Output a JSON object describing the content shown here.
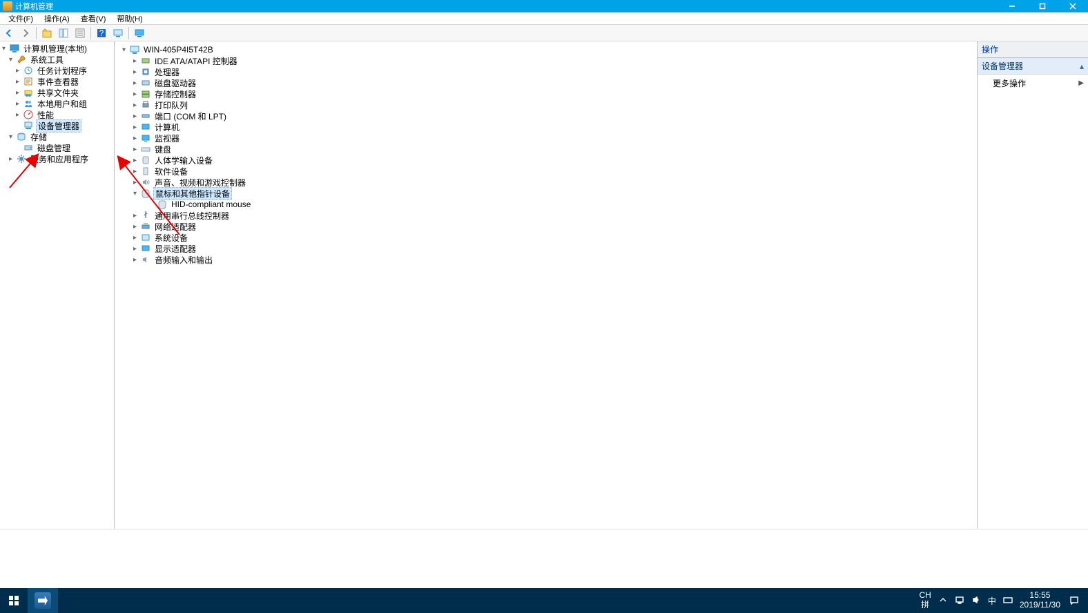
{
  "window": {
    "title": "计算机管理"
  },
  "menu": {
    "file": "文件(F)",
    "action": "操作(A)",
    "view": "查看(V)",
    "help": "帮助(H)"
  },
  "left_tree": {
    "root": "计算机管理(本地)",
    "sys_tools": "系统工具",
    "task_sched": "任务计划程序",
    "event_viewer": "事件查看器",
    "shared_folders": "共享文件夹",
    "local_users": "本地用户和组",
    "performance": "性能",
    "device_manager": "设备管理器",
    "storage": "存储",
    "disk_mgmt": "磁盘管理",
    "services": "服务和应用程序"
  },
  "device_tree": {
    "computer": "WIN-405P4I5T42B",
    "ide": "IDE ATA/ATAPI 控制器",
    "cpu": "处理器",
    "disk": "磁盘驱动器",
    "storage_ctrl": "存储控制器",
    "print": "打印队列",
    "ports": "端口 (COM 和 LPT)",
    "computers": "计算机",
    "monitor": "监视器",
    "keyboard": "键盘",
    "hid": "人体学输入设备",
    "software_dev": "软件设备",
    "sound": "声音、视频和游戏控制器",
    "mouse_cat": "鼠标和其他指针设备",
    "mouse_child": "HID-compliant mouse",
    "usb": "通用串行总线控制器",
    "network": "网络适配器",
    "system_dev": "系统设备",
    "display": "显示适配器",
    "audio_io": "音频输入和输出"
  },
  "actions": {
    "header": "操作",
    "group": "设备管理器",
    "more": "更多操作"
  },
  "systray": {
    "ime_lang": "CH",
    "ime_pin": "拼",
    "ime_zh": "中",
    "time": "15:55",
    "date": "2019/11/30"
  }
}
